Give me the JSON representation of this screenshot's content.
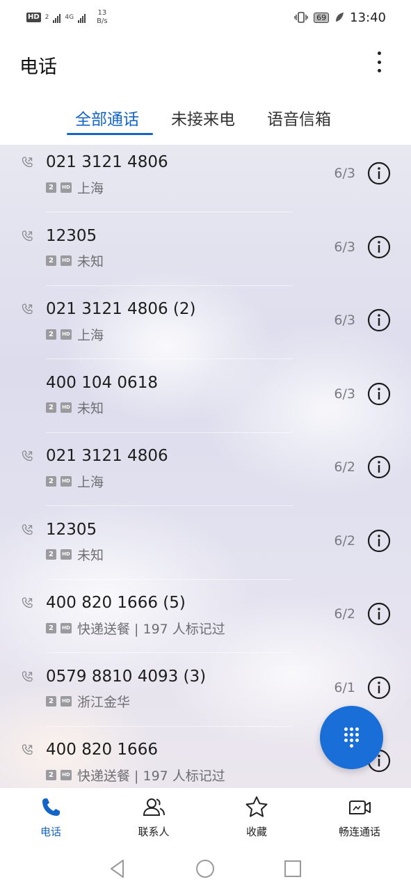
{
  "status_bar": {
    "hd": "HD",
    "sim": "2",
    "network": "4G",
    "net_speed_value": "13",
    "net_speed_unit": "B/s",
    "battery": "69",
    "time": "13:40"
  },
  "header": {
    "title": "电话"
  },
  "tabs": [
    {
      "label": "全部通话",
      "active": true
    },
    {
      "label": "未接来电",
      "active": false
    },
    {
      "label": "语音信箱",
      "active": false
    }
  ],
  "calls": [
    {
      "number": "021 3121 4806",
      "location": "上海",
      "date": "6/3",
      "sim": "2",
      "hd": "HD",
      "has_call_icon": true
    },
    {
      "number": "12305",
      "location": "未知",
      "date": "6/3",
      "sim": "2",
      "hd": "HD",
      "has_call_icon": true
    },
    {
      "number": "021 3121 4806 (2)",
      "location": "上海",
      "date": "6/3",
      "sim": "2",
      "hd": "HD",
      "has_call_icon": true
    },
    {
      "number": "400 104 0618",
      "location": "未知",
      "date": "6/3",
      "sim": "2",
      "hd": "HD",
      "has_call_icon": false
    },
    {
      "number": "021 3121 4806",
      "location": "上海",
      "date": "6/2",
      "sim": "2",
      "hd": "HD",
      "has_call_icon": true
    },
    {
      "number": "12305",
      "location": "未知",
      "date": "6/2",
      "sim": "2",
      "hd": "HD",
      "has_call_icon": true
    },
    {
      "number": "400 820 1666 (5)",
      "location": "快递送餐 | 197 人标记过",
      "date": "6/2",
      "sim": "2",
      "hd": "HD",
      "has_call_icon": true
    },
    {
      "number": "0579 8810 4093 (3)",
      "location": "浙江金华",
      "date": "6/1",
      "sim": "2",
      "hd": "HD",
      "has_call_icon": true
    },
    {
      "number": "400 820 1666",
      "location": "快递送餐 | 197 人标记过",
      "date": "",
      "sim": "2",
      "hd": "HD",
      "has_call_icon": true
    }
  ],
  "bottom_nav": [
    {
      "label": "电话",
      "icon": "phone-icon",
      "active": true
    },
    {
      "label": "联系人",
      "icon": "contacts-icon",
      "active": false
    },
    {
      "label": "收藏",
      "icon": "star-icon",
      "active": false
    },
    {
      "label": "畅连通话",
      "icon": "video-call-icon",
      "active": false
    }
  ],
  "colors": {
    "accent": "#1465c8",
    "fab": "#1a6ed8"
  }
}
